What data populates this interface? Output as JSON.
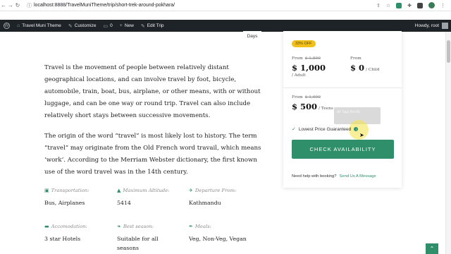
{
  "browser": {
    "url": "localhost:8888/TravelMuniTheme/trip/short-trek-around-pokhara/"
  },
  "admin_bar": {
    "site_name": "Travel Muni Theme",
    "customize": "Customize",
    "comments_count": "0",
    "new": "New",
    "edit_trip": "Edit Trip",
    "howdy": "Howdy, root"
  },
  "trip": {
    "days_tab": "Days",
    "paragraphs": [
      "Travel is the movement of people between relatively distant geographical locations, and can involve travel by foot, bicycle, automobile, train, boat, bus, airplane, or other means, with or without luggage, and can be one way or round trip. Travel can also include relatively short stays between successive movements.",
      "The origin of the word “travel” is most likely lost to history. The term “travel” may originate from the Old French word travail, which means ‘work’. According to the Merriam Webster dictionary, the first known use of the word travel was in the 14th century."
    ],
    "facts": [
      {
        "label": "Transportation:",
        "value": "Bus, Airplanes",
        "icon": "bus-icon"
      },
      {
        "label": "Maximum Altitude:",
        "value": "5414",
        "icon": "mountain-icon"
      },
      {
        "label": "Departure From:",
        "value": "Kathmandu",
        "icon": "plane-icon"
      },
      {
        "label": "Accomodation:",
        "value": "3 star Hotels",
        "icon": "bed-icon"
      },
      {
        "label": "Best season:",
        "value": "Suitable for all seasons",
        "icon": "leaf-icon"
      },
      {
        "label": "Meals:",
        "value": "Veg, Non-Veg, Vegan",
        "icon": "cutlery-icon"
      }
    ]
  },
  "booking": {
    "discount_badge": "33% OFF",
    "adult": {
      "from_label": "From",
      "old_price": "$ 1,500",
      "price": "$ 1,000",
      "unit": "/ Adult"
    },
    "child": {
      "from_label": "From",
      "price": "$ 0",
      "unit": "/ Child"
    },
    "teens": {
      "from_label": "From",
      "old_price": "$ 1,000",
      "price": "$ 500",
      "unit": "/ Teens"
    },
    "tooltip": "All Tags Bst All",
    "guarantee": "Lowest Price Guaranteed",
    "cta": "CHECK AVAILABILITY",
    "help_text": "Need help with booking?",
    "help_link": "Send Us A Message"
  },
  "colors": {
    "accent": "#2f8f6a",
    "badge": "#f2c01a",
    "admin_bar": "#1d2327"
  }
}
